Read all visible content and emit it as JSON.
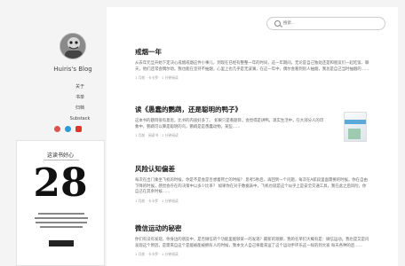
{
  "sidebar": {
    "blog_title": "Huiris's Blog",
    "nav": [
      "关于",
      "书单",
      "归档",
      "Substack"
    ],
    "social_icons": [
      "weibo-icon",
      "telegram-icon",
      "youtube-icon"
    ],
    "promo": {
      "kicker": "这读书好心",
      "number": "28"
    }
  },
  "search": {
    "placeholder": "搜索..."
  },
  "articles": [
    {
      "title": "戒烟一年",
      "excerpt": "从去年元旦开始下定决心戒烟戒烟这件小事儿，到现在已经有整整一年的时间，这一年期间，无论是自己独处还是和朋友们一起吃饭、聊天，他们还常会偶尔劝，我也能在坚持不抽烟，心里上也几乎是无波澜，在这一年中，偶尔会看到别人抽烟，我总是自己当时抽烟的……",
      "meta": "1 月前 · 卡卡罗 · 1 分钟阅读"
    },
    {
      "title": "读《愚蠢的鹦鹉，还是聪明的鸭子》",
      "excerpt": "这本书的题目很有意思，比书的内容好多了。 如果只是看题目，会觉得是讲鸭。现实生活中，在大部分人的印象中，鹦鹉可以算是聪明的鸟，鹦鹉是是愚蠢动物，某些……",
      "meta": "1 月前 · 阅读书 · 1 分钟阅读"
    },
    {
      "title": "风险认知偏差",
      "excerpt": "每次在出门乘坐飞机的时候，你是不是会是否想着死亡的时候？ 思考5秒后，再回到一个问题，每次在A航段里面需要的时候，你在自由下降的时候，感觉会存在的决策中以多少比率？ 如果你在对于数据表中，飞机也就是这个似乎上是安全交通工具，我在此之后风险，你自己在其余时候……",
      "meta": "1 月前 · 卡卡罗 · 1 分钟阅读"
    },
    {
      "title": "微信运动的秘密",
      "excerpt": "你们有没有发现，你身边的朋友中，是否微信的个功能里能够某一的发现？最新的观察，我的名单们大概有是：微信运动。我也是又是问发现这个原因，是需来自这个是能被能被拥有人的时候，我本文人自己将着来运了这个运动手环乐这一样的到大家 每天各种的后……",
      "meta": "1 月前 · 卡卡罗 · 1 分钟阅读"
    }
  ]
}
